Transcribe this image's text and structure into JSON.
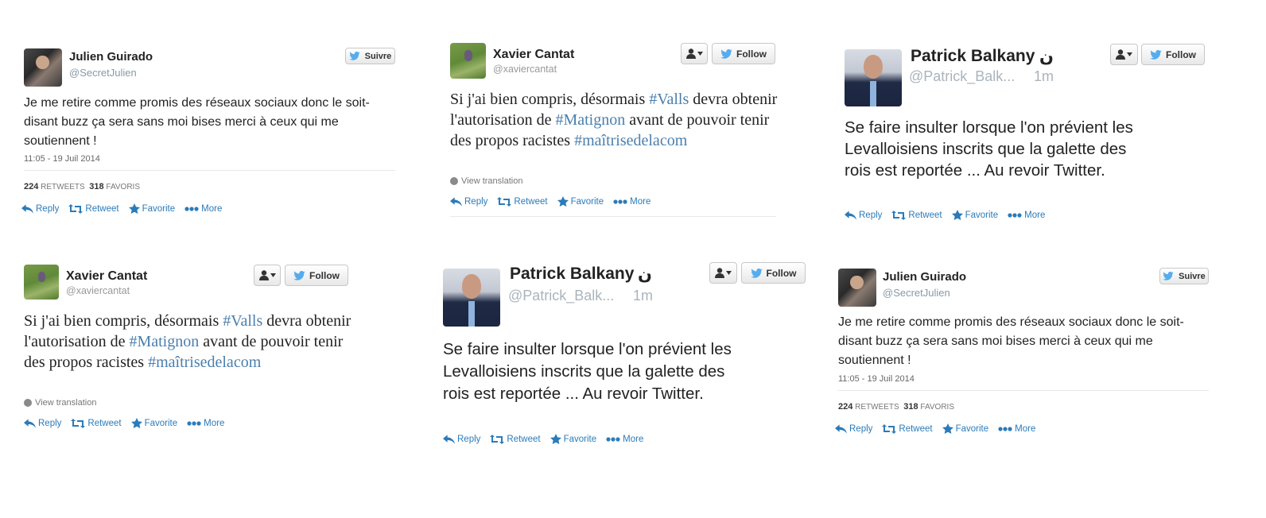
{
  "buttons": {
    "suivre": "Suivre",
    "follow": "Follow"
  },
  "actions": {
    "reply": "Reply",
    "retweet": "Retweet",
    "favorite": "Favorite",
    "more": "More"
  },
  "julien": {
    "name": "Julien Guirado",
    "handle": "@SecretJulien",
    "text": "Je me retire comme promis des réseaux sociaux donc le soit-disant buzz ça sera sans moi bises merci à ceux qui me soutiennent !",
    "date": "11:05 - 19 Juil 2014",
    "retweets": "224",
    "retweets_label": "RETWEETS",
    "favoris": "318",
    "favoris_label": "FAVORIS"
  },
  "xavier": {
    "name": "Xavier Cantat",
    "handle": "@xaviercantat",
    "text_1": "Si j'ai bien compris, désormais ",
    "tag_1": "#Valls",
    "text_2": " devra obtenir l'autorisation de ",
    "tag_2": "#Matignon",
    "text_3": " avant de pouvoir tenir des propos racistes ",
    "tag_3": "#maîtrisedelacom",
    "view_translation": "View translation"
  },
  "patrick": {
    "name": "Patrick Balkany",
    "arabic": "ن",
    "handle": "@Patrick_Balk...",
    "time": "1m",
    "text": "Se faire insulter lorsque l'on prévient les Levalloisiens inscrits que la galette des rois est reportée ... Au revoir Twitter."
  },
  "colors": {
    "link": "#2b7bb9",
    "hashtag": "#4a7fad",
    "muted": "#8899a6"
  },
  "icons": [
    "user-icon",
    "chevron-down-icon",
    "twitter-bird-icon",
    "reply-icon",
    "retweet-icon",
    "star-icon",
    "more-dots-icon",
    "globe-icon"
  ]
}
